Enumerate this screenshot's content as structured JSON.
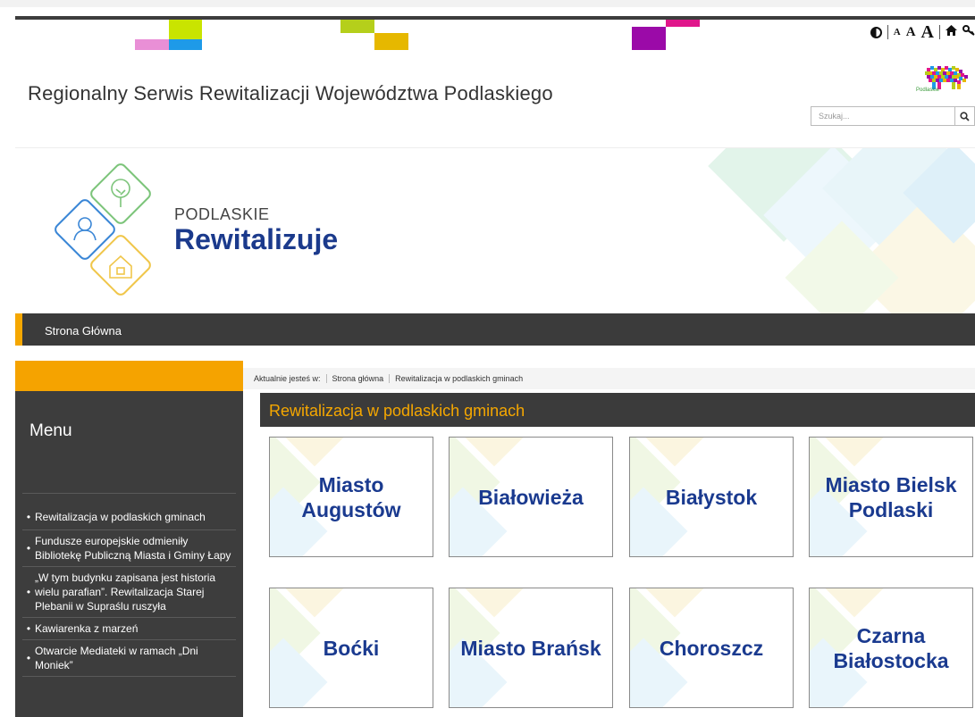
{
  "toolbar": {
    "contrast_icon": "contrast-icon",
    "font_small": "A",
    "font_medium": "A",
    "font_large": "A",
    "home_icon": "home-icon",
    "sitemap_icon": "key-icon"
  },
  "header": {
    "title": "Regionalny Serwis Rewitalizacji Województwa Podlaskiego",
    "logo_text": "Podlaskie",
    "search_placeholder": "Szukaj...",
    "search_icon": "search-icon"
  },
  "banner": {
    "subtitle": "PODLASKIE",
    "title": "Rewitalizuje"
  },
  "nav": {
    "items": [
      {
        "label": "Strona Główna"
      }
    ]
  },
  "sidebar": {
    "title": "Menu",
    "items": [
      {
        "label": "Rewitalizacja w podlaskich gminach"
      },
      {
        "label": "Fundusze europejskie odmieniły Bibliotekę Publiczną Miasta i Gminy Łapy"
      },
      {
        "label": "„W tym budynku zapisana jest historia wielu parafian”. Rewitalizacja Starej Plebanii w Supraślu ruszyła"
      },
      {
        "label": "Kawiarenka z marzeń"
      },
      {
        "label": "Otwarcie Mediateki w ramach „Dni Moniek”"
      }
    ]
  },
  "breadcrumb": {
    "prefix": "Aktualnie jesteś w:",
    "items": [
      "Strona główna",
      "Rewitalizacja w podlaskich gminach"
    ]
  },
  "section": {
    "title": "Rewitalizacja w podlaskich gminach"
  },
  "tiles": [
    {
      "label": "Miasto Augustów"
    },
    {
      "label": "Białowieża"
    },
    {
      "label": "Białystok"
    },
    {
      "label": "Miasto Bielsk Podlaski"
    },
    {
      "label": "Boćki"
    },
    {
      "label": "Miasto Brańsk"
    },
    {
      "label": "Choroszcz"
    },
    {
      "label": "Czarna Białostocka"
    }
  ],
  "colors": {
    "accent": "#f5a700",
    "dark": "#3b3b3b",
    "brand_blue": "#1a3a8f"
  }
}
